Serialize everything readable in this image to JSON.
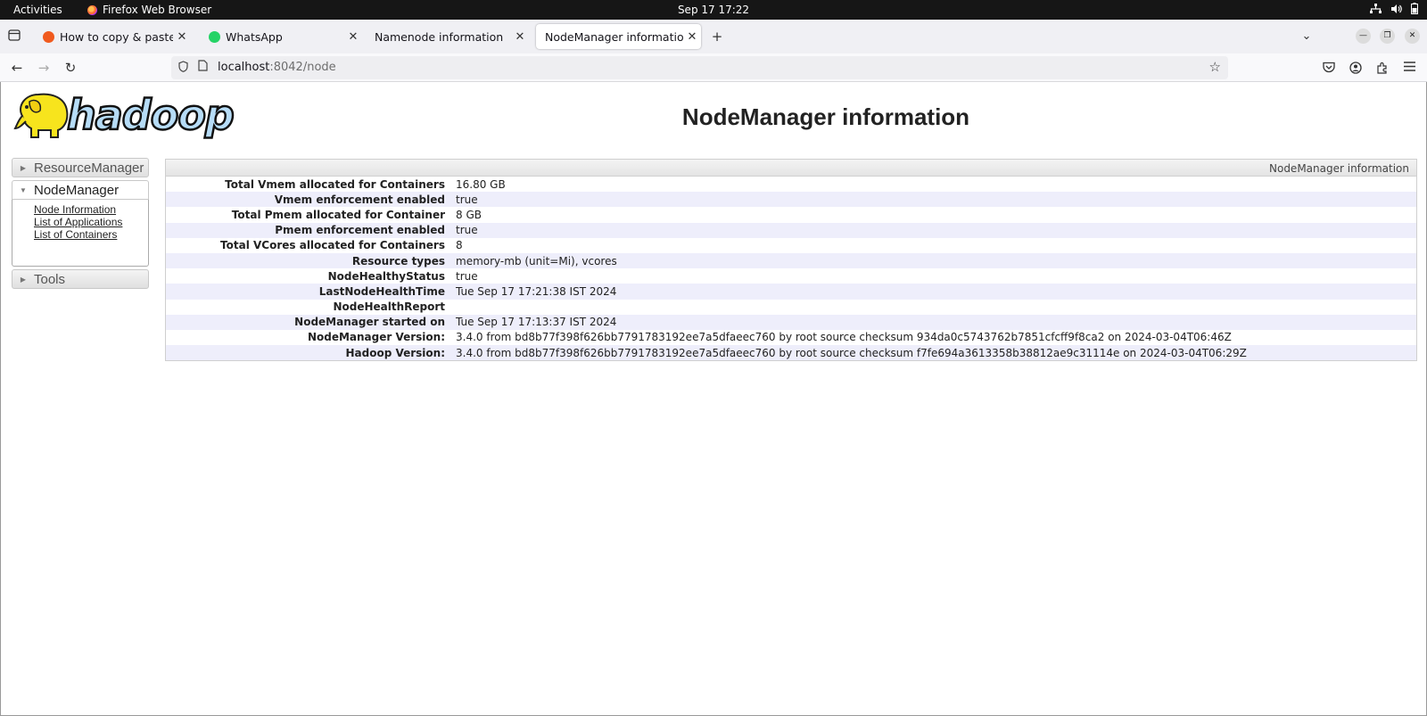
{
  "system_bar": {
    "activities": "Activities",
    "app_name": "Firefox Web Browser",
    "clock": "Sep 17  17:22"
  },
  "tabs": [
    {
      "title": "How to copy & paste from",
      "favicon_color": "#f05a1e"
    },
    {
      "title": "WhatsApp",
      "favicon_color": "#25d366"
    },
    {
      "title": "Namenode information",
      "favicon_color": ""
    },
    {
      "title": "NodeManager information",
      "favicon_color": ""
    }
  ],
  "address": {
    "host": "localhost",
    "path": ":8042/node"
  },
  "page": {
    "logo_text": "hadoop",
    "title": "NodeManager information"
  },
  "sidebar": {
    "sections": [
      {
        "label": "ResourceManager"
      },
      {
        "label": "NodeManager",
        "links": [
          "Node Information",
          "List of Applications",
          "List of Containers"
        ]
      },
      {
        "label": "Tools"
      }
    ]
  },
  "info_table": {
    "caption": "NodeManager information",
    "rows": [
      {
        "key": "Total Vmem allocated for Containers",
        "value": "16.80 GB"
      },
      {
        "key": "Vmem enforcement enabled",
        "value": "true"
      },
      {
        "key": "Total Pmem allocated for Container",
        "value": "8 GB"
      },
      {
        "key": "Pmem enforcement enabled",
        "value": "true"
      },
      {
        "key": "Total VCores allocated for Containers",
        "value": "8"
      },
      {
        "key": "Resource types",
        "value": "memory-mb (unit=Mi), vcores"
      },
      {
        "key": "NodeHealthyStatus",
        "value": "true"
      },
      {
        "key": "LastNodeHealthTime",
        "value": "Tue Sep 17 17:21:38 IST 2024"
      },
      {
        "key": "NodeHealthReport",
        "value": ""
      },
      {
        "key": "NodeManager started on",
        "value": "Tue Sep 17 17:13:37 IST 2024"
      },
      {
        "key": "NodeManager Version:",
        "value": "3.4.0 from bd8b77f398f626bb7791783192ee7a5dfaeec760 by root source checksum 934da0c5743762b7851cfcff9f8ca2 on 2024-03-04T06:46Z"
      },
      {
        "key": "Hadoop Version:",
        "value": "3.4.0 from bd8b77f398f626bb7791783192ee7a5dfaeec760 by root source checksum f7fe694a3613358b38812ae9c31114e on 2024-03-04T06:29Z"
      }
    ]
  }
}
